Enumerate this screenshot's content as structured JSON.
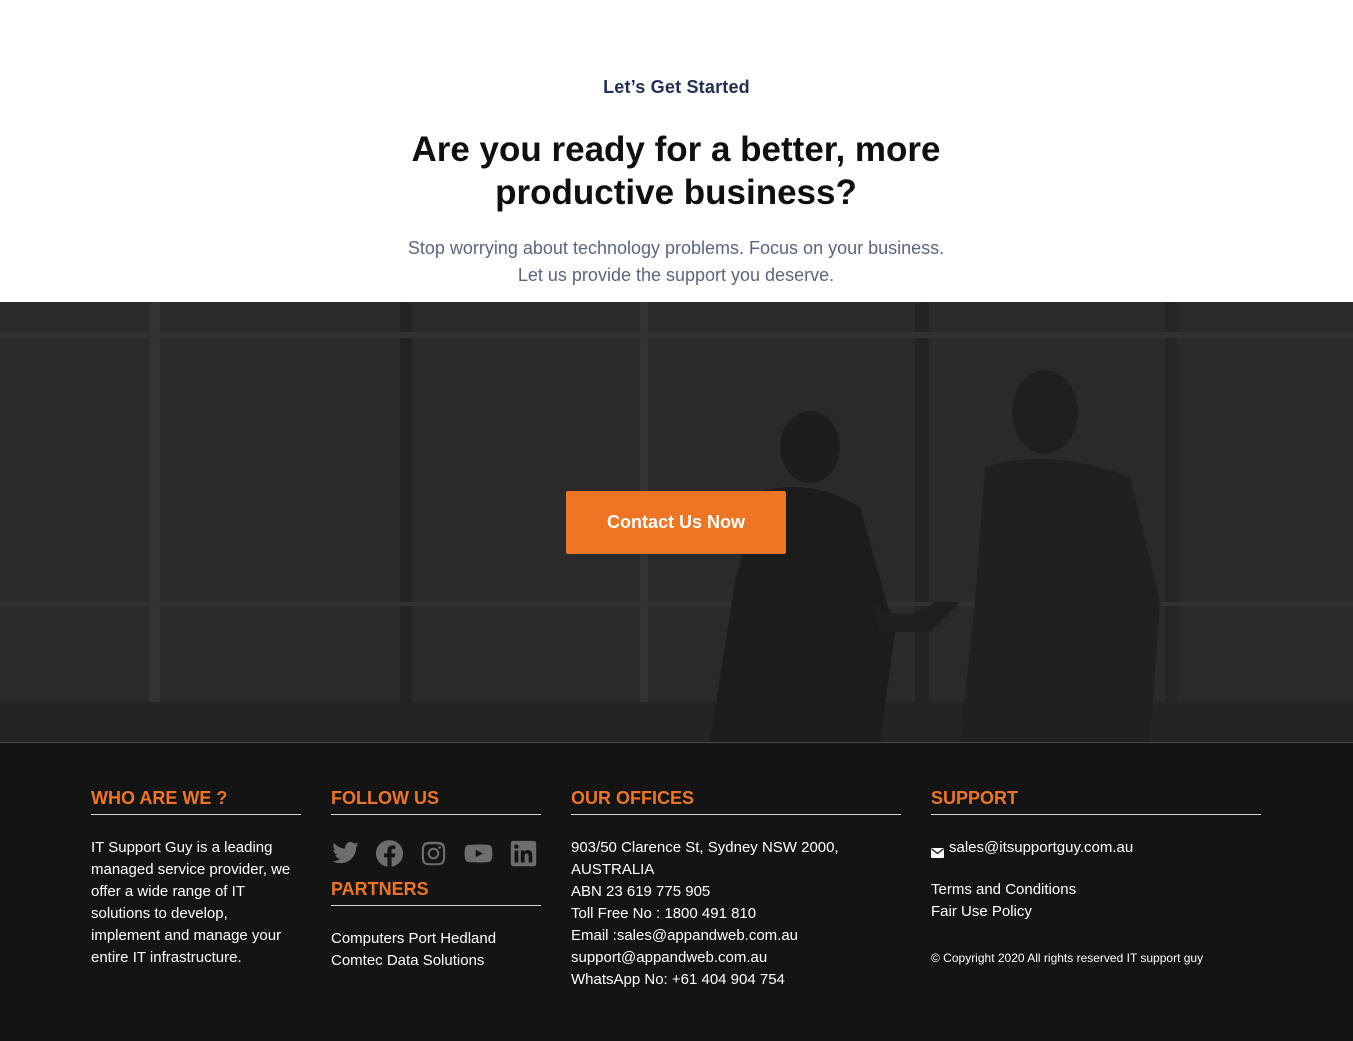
{
  "intro": {
    "eyebrow": "Let’s Get Started",
    "headline_line1": "Are you ready for a better, more",
    "headline_line2": "productive business?",
    "sub_line1": "Stop worrying about technology problems. Focus on your business.",
    "sub_line2": "Let us provide the support you deserve."
  },
  "hero": {
    "cta_label": "Contact Us Now"
  },
  "footer": {
    "who": {
      "title": "WHO ARE WE ?",
      "text": "IT Support Guy is a leading managed service provider, we offer a wide range of IT solutions to develop, implement and manage your entire IT infrastructure."
    },
    "follow": {
      "title": "FOLLOW US",
      "icons": [
        "twitter-icon",
        "facebook-icon",
        "instagram-icon",
        "youtube-icon",
        "linkedin-icon"
      ]
    },
    "partners": {
      "title": "PARTNERS",
      "items": [
        "Computers Port Hedland",
        "Comtec Data Solutions"
      ]
    },
    "offices": {
      "title": "OUR OFFICES",
      "lines": [
        "903/50 Clarence St, Sydney NSW 2000,",
        "AUSTRALIA",
        "ABN 23 619 775 905",
        "Toll Free No : 1800 491 810",
        "Email :sales@appandweb.com.au",
        "support@appandweb.com.au",
        "WhatsApp No: +61 404 904 754"
      ]
    },
    "support": {
      "title": "SUPPORT",
      "email": "sales@itsupportguy.com.au",
      "links": [
        "Terms and Conditions",
        "Fair Use Policy"
      ],
      "copyright": "© Copyright 2020 All rights reserved IT support guy"
    }
  },
  "colors": {
    "accent": "#ee7623",
    "navy": "#1f2f57",
    "footer_bg": "#141414"
  }
}
